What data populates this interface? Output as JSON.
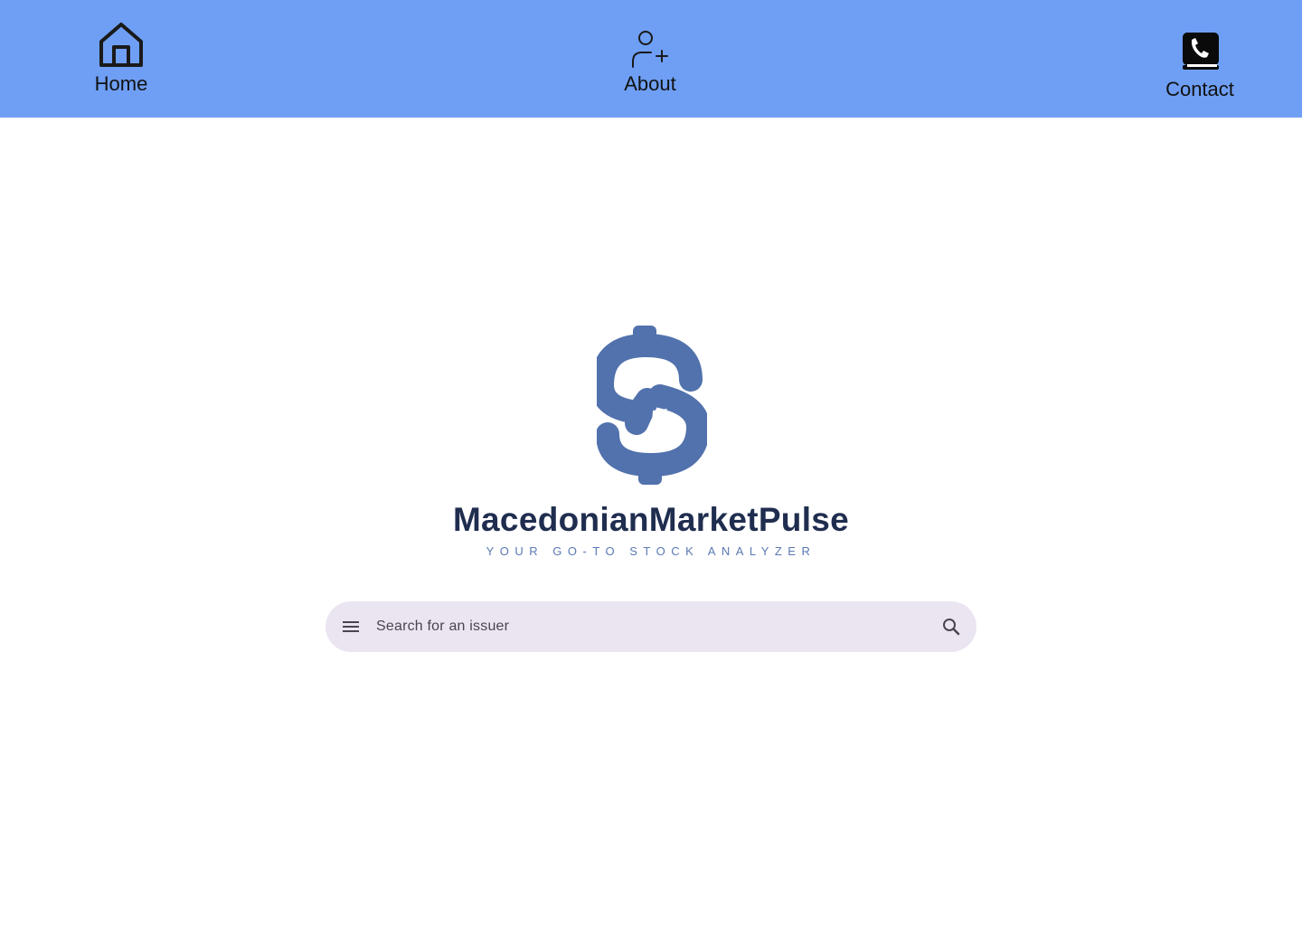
{
  "nav": {
    "home": {
      "label": "Home",
      "icon": "home-icon"
    },
    "about": {
      "label": "About",
      "icon": "add-user-icon"
    },
    "contact": {
      "label": "Contact",
      "icon": "phone-book-icon"
    }
  },
  "logo": {
    "brand_name": "MacedonianMarketPulse",
    "tagline": "YOUR GO-TO STOCK ANALYZER",
    "icon": "dollar-sign-icon"
  },
  "search": {
    "placeholder": "Search for an issuer",
    "value": "",
    "menu_icon": "menu-icon",
    "search_icon": "search-icon"
  },
  "colors": {
    "navbar": "#6e9ff5",
    "brand_dark": "#1f2d4f",
    "brand_accent": "#5a79b3",
    "dollar": "#5272ad",
    "search_bg": "#ebe5f1"
  }
}
